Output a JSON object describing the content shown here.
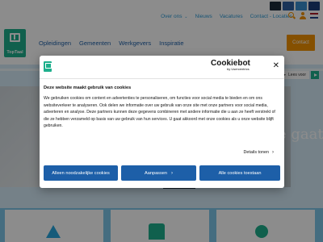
{
  "header": {
    "topnav": [
      {
        "label": "Over ons",
        "has_chevron": true
      },
      {
        "label": "Nieuws"
      },
      {
        "label": "Vacatures"
      },
      {
        "label": "Contact - Locaties"
      }
    ],
    "logo_text": "TopTaal",
    "mainnav": [
      "Opleidingen",
      "Gemeenten",
      "Werkgevers",
      "Inspiratie"
    ],
    "contact_label": "Contact",
    "chevron": "⌄"
  },
  "hero": {
    "title_fragment": "e gaat",
    "leesvoor_label": "Lees voor",
    "leesvoor_icon": "▸"
  },
  "cookie_dialog": {
    "brand_name": "Cookiebot",
    "brand_by": "by Usercentrics",
    "close_symbol": "✕",
    "title": "Deze website maakt gebruik van cookies",
    "body": "We gebruiken cookies om content en advertenties te personaliseren, om functies voor social media te bieden en om ons websiteverkeer te analyseren. Ook delen we informatie over uw gebruik van onze site met onze partners voor social media, adverteren en analyse. Deze partners kunnen deze gegevens combineren met andere informatie die u aan ze heeft verstrekt of die ze hebben verzameld op basis van uw gebruik van hun services. U gaat akkoord met onze cookies als u onze website blijft gebruiken.",
    "details_label": "Details tonen",
    "details_chevron": "›",
    "buttons": {
      "deny": "Alleen noodzakelijke cookies",
      "customize": "Aanpassen",
      "customize_chevron": "›",
      "allow": "Alle cookies toestaan"
    }
  },
  "colors": {
    "brand_green": "#1eaf8c",
    "brand_blue": "#1d5fa8",
    "accent_orange": "#f39200",
    "link_blue": "#2f9bd6"
  }
}
